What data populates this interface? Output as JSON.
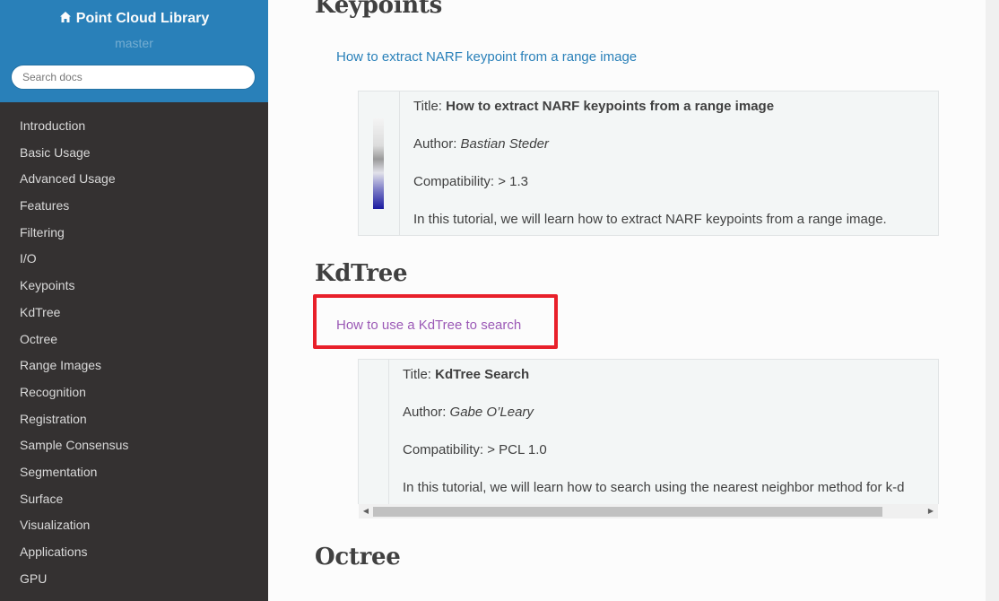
{
  "sidebar": {
    "brand": "Point Cloud Library",
    "version": "master",
    "search_placeholder": "Search docs",
    "items": [
      {
        "label": "Introduction"
      },
      {
        "label": "Basic Usage"
      },
      {
        "label": "Advanced Usage"
      },
      {
        "label": "Features"
      },
      {
        "label": "Filtering"
      },
      {
        "label": "I/O"
      },
      {
        "label": "Keypoints"
      },
      {
        "label": "KdTree"
      },
      {
        "label": "Octree"
      },
      {
        "label": "Range Images"
      },
      {
        "label": "Recognition"
      },
      {
        "label": "Registration"
      },
      {
        "label": "Sample Consensus"
      },
      {
        "label": "Segmentation"
      },
      {
        "label": "Surface"
      },
      {
        "label": "Visualization"
      },
      {
        "label": "Applications"
      },
      {
        "label": "GPU"
      }
    ]
  },
  "sections": {
    "keypoints": {
      "heading": "Keypoints",
      "link": "How to extract NARF keypoint from a range image",
      "card": {
        "title_label": "Title: ",
        "title": "How to extract NARF keypoints from a range image",
        "author_label": "Author: ",
        "author": "Bastian Steder",
        "compat_label": "Compatibility: ",
        "compat": "> 1.3",
        "description": "In this tutorial, we will learn how to extract NARF keypoints from a range image."
      }
    },
    "kdtree": {
      "heading": "KdTree",
      "link": "How to use a KdTree to search",
      "card": {
        "title_label": "Title: ",
        "title": "KdTree Search",
        "author_label": "Author: ",
        "author": "Gabe O’Leary",
        "compat_label": "Compatibility: ",
        "compat": "> PCL 1.0",
        "description": "In this tutorial, we will learn how to search using the nearest neighbor method for k-d"
      }
    },
    "octree": {
      "heading": "Octree"
    }
  },
  "colors": {
    "sidebar_top": "#2980b9",
    "sidebar_bg": "#343131",
    "link": "#2980b9",
    "visited_link": "#9b59b6",
    "highlight": "#e8202a"
  },
  "icons": [
    "home-icon",
    "scroll-left-arrow-icon",
    "scroll-right-arrow-icon"
  ]
}
